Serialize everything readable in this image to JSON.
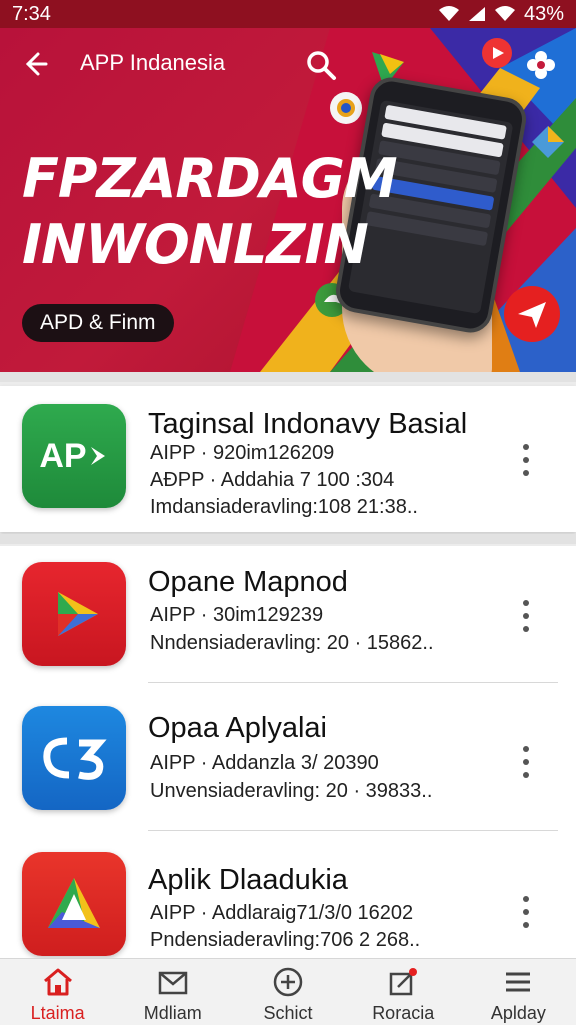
{
  "status": {
    "time": "7:34",
    "battery": "43%"
  },
  "header": {
    "title": "APP Indanesia"
  },
  "banner": {
    "headline_line1": "FPZARDAGM",
    "headline_line2": "INWONLZIN",
    "pill_label": "APD & Finm"
  },
  "apps": [
    {
      "name": "Taginsal Indonavy Basial",
      "line1": "AIPP · 920im126209",
      "line2": "AÐPP · Addahia 7 100 :304",
      "line3": "Imdansiaderavling:108 21:38..",
      "icon_text": "AP"
    },
    {
      "name": "Opane Mapnod",
      "line1": "AIPP · 30im129239",
      "line2": "Nndensiaderavling: 20 · 15862..",
      "line3": ""
    },
    {
      "name": "Opaa Aplyalai",
      "line1": "AIPP · Addanzla 3/ 20390",
      "line2": "Unvensiaderavling: 20 · 39833..",
      "line3": ""
    },
    {
      "name": "Aplik Dlaadukia",
      "line1": "AIPP · Addlaraig71/3/0 16202",
      "line2": "Pndensiaderavling:706 2 268..",
      "line3": ""
    }
  ],
  "nav": [
    {
      "label": "Ltaima"
    },
    {
      "label": "Mdliam"
    },
    {
      "label": "Schict"
    },
    {
      "label": "Roracia"
    },
    {
      "label": "Aplday"
    }
  ],
  "colors": {
    "brand_red": "#c41a3a",
    "active_nav": "#d92020"
  }
}
